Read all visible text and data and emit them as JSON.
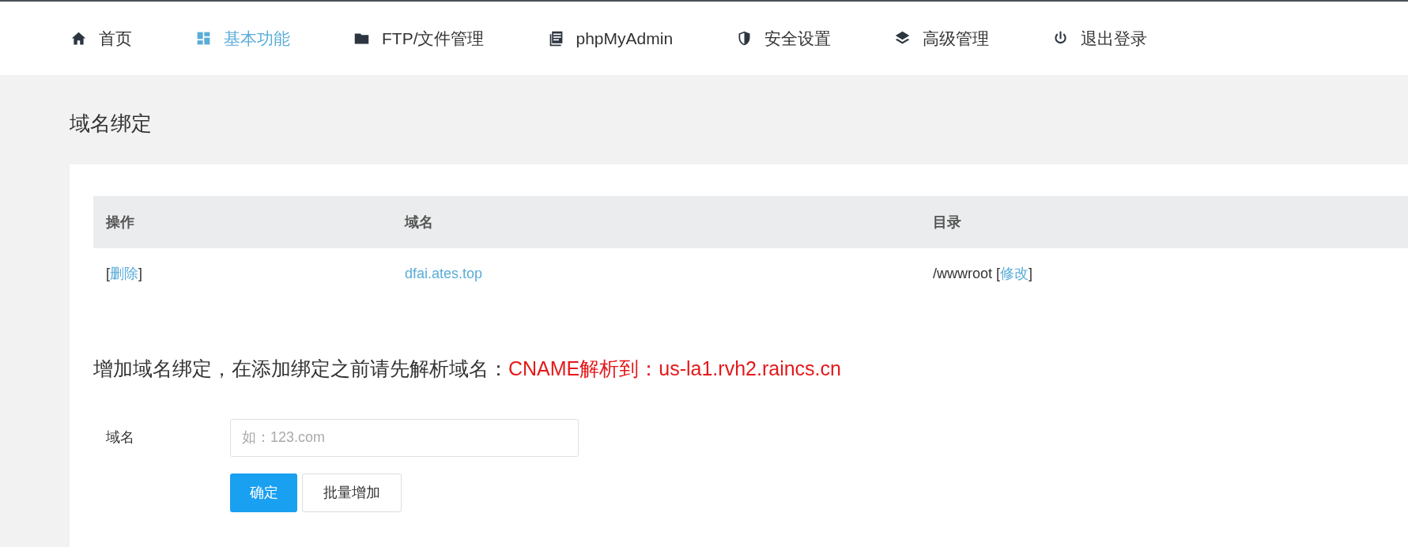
{
  "nav": [
    {
      "label": "首页",
      "selected": false
    },
    {
      "label": "基本功能",
      "selected": true
    },
    {
      "label": "FTP/文件管理",
      "selected": false
    },
    {
      "label": "phpMyAdmin",
      "selected": false
    },
    {
      "label": "安全设置",
      "selected": false
    },
    {
      "label": "高级管理",
      "selected": false
    },
    {
      "label": "退出登录",
      "selected": false
    }
  ],
  "page_title": "域名绑定",
  "table": {
    "columns": [
      "操作",
      "域名",
      "目录"
    ],
    "rows": [
      {
        "action_open": "[",
        "action_link": "删除",
        "action_close": "]",
        "domain": "dfai.ates.top",
        "dir": "/wwwroot",
        "dir_open": "[",
        "dir_link": "修改",
        "dir_close": "]"
      }
    ]
  },
  "notice": {
    "text": "增加域名绑定，在添加绑定之前请先解析域名：",
    "highlight": "CNAME解析到：us-la1.rvh2.raincs.cn"
  },
  "form": {
    "label": "域名",
    "placeholder": "如：123.com",
    "buttons": [
      {
        "label": "确定",
        "kind": "primary"
      },
      {
        "label": "批量增加",
        "kind": "default"
      }
    ]
  }
}
